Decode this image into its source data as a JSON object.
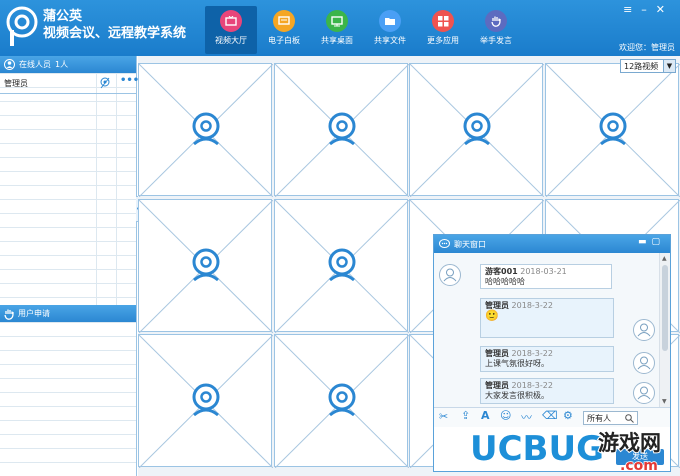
{
  "app": {
    "title_line1": "蒲公英",
    "title_line2": "视频会议、远程教学系统",
    "welcome": "欢迎您：管理员"
  },
  "window_controls": {
    "menu": "≡",
    "minimize": "–",
    "close": "✕"
  },
  "nav": [
    {
      "label": "视频大厅",
      "icon": "tv-icon",
      "color": "#e8457a",
      "active": true
    },
    {
      "label": "电子白板",
      "icon": "whiteboard-icon",
      "color": "#f5a623"
    },
    {
      "label": "共享桌面",
      "icon": "monitor-icon",
      "color": "#3bb54a"
    },
    {
      "label": "共享文件",
      "icon": "folder-icon",
      "color": "#4a9ff5"
    },
    {
      "label": "更多应用",
      "icon": "apps-icon",
      "color": "#ef5350"
    },
    {
      "label": "举手发言",
      "icon": "hand-icon",
      "color": "#5c6bc0"
    }
  ],
  "online": {
    "title": "在线人员",
    "count": "1人",
    "users": [
      {
        "name": "管理员"
      }
    ]
  },
  "requests": {
    "title": "用户申请"
  },
  "video": {
    "layout_option": "12路视频"
  },
  "chat": {
    "title": "聊天窗口",
    "messages": [
      {
        "sender": "游客001",
        "time": "2018-03-21",
        "text": "哈哈哈哈哈",
        "self": false
      },
      {
        "sender": "管理员",
        "time": "2018-3-22",
        "text": "🙂",
        "self": true
      },
      {
        "sender": "管理员",
        "time": "2018-3-22",
        "text": "上课气氛很好呀。",
        "self": true
      },
      {
        "sender": "管理员",
        "time": "2018-3-22",
        "text": "大家发言很积极。",
        "self": true
      }
    ],
    "recipient": "所有人",
    "send_label": "发送"
  },
  "watermark": {
    "text1": "UCBUG",
    "text2": "游戏网",
    "text3": ".com"
  }
}
